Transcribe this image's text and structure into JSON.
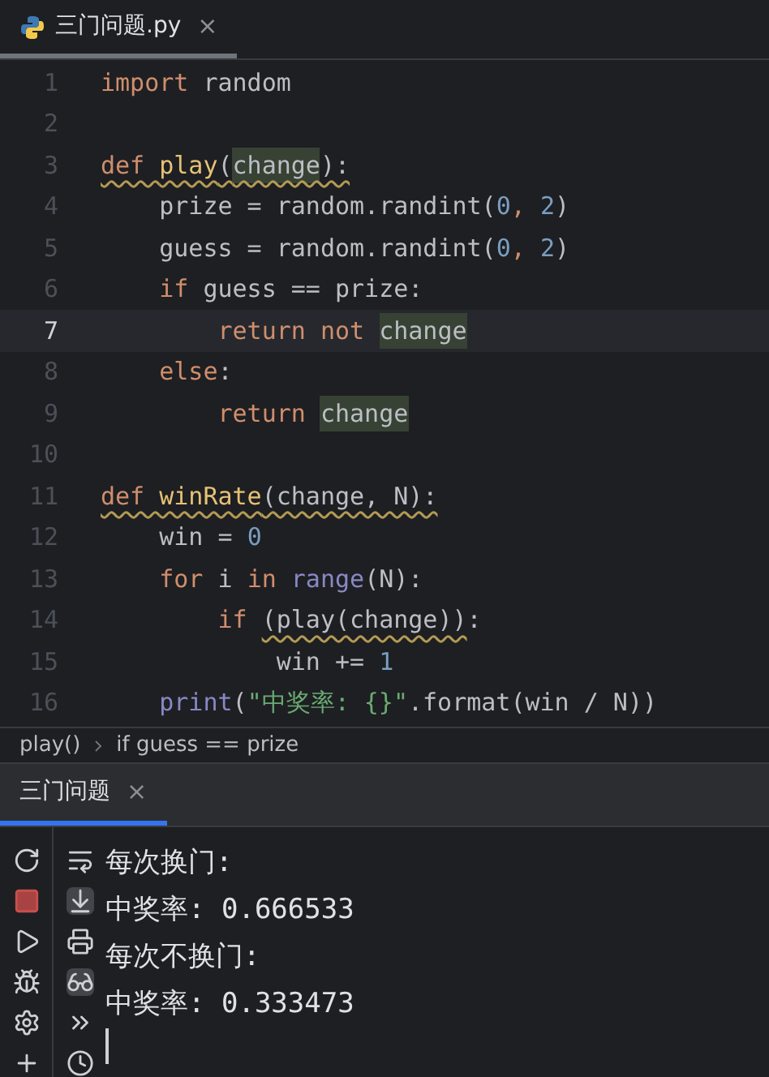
{
  "editor_tab": {
    "title": "三门问题.py",
    "close": "×",
    "selected": true
  },
  "lines": [
    {
      "number": "1",
      "current": false,
      "tokens": [
        {
          "text": "import",
          "kind": "keyword"
        },
        {
          "text": " random",
          "kind": "text"
        }
      ]
    },
    {
      "number": "2",
      "current": false
    },
    {
      "number": "3",
      "current": false,
      "tokens": [
        {
          "text": "def ",
          "kind": "keyword",
          "warning": true
        },
        {
          "text": "play",
          "kind": "func",
          "warning": true
        },
        {
          "text": "(",
          "kind": "text",
          "warning": true
        },
        {
          "text": "change",
          "kind": "text",
          "warning": true,
          "highlighted": true
        },
        {
          "text": "):",
          "kind": "text",
          "warning": true
        }
      ]
    },
    {
      "number": "4",
      "current": false,
      "tokens": [
        {
          "text": "    prize = random.randint(",
          "kind": "text"
        },
        {
          "text": "0",
          "kind": "number"
        },
        {
          "text": ", ",
          "kind": "keyword"
        },
        {
          "text": "2",
          "kind": "number"
        },
        {
          "text": ")",
          "kind": "text"
        }
      ]
    },
    {
      "number": "5",
      "current": false,
      "tokens": [
        {
          "text": "    guess = random.randint(",
          "kind": "text"
        },
        {
          "text": "0",
          "kind": "number"
        },
        {
          "text": ", ",
          "kind": "keyword"
        },
        {
          "text": "2",
          "kind": "number"
        },
        {
          "text": ")",
          "kind": "text"
        }
      ]
    },
    {
      "number": "6",
      "current": false,
      "tokens": [
        {
          "text": "    if",
          "kind": "keyword"
        },
        {
          "text": " guess == prize:",
          "kind": "text"
        }
      ]
    },
    {
      "number": "7",
      "current": true,
      "tokens": [
        {
          "text": "        return not ",
          "kind": "keyword"
        },
        {
          "text": "change",
          "kind": "text",
          "highlighted": true
        }
      ]
    },
    {
      "number": "8",
      "current": false,
      "tokens": [
        {
          "text": "    else",
          "kind": "keyword"
        },
        {
          "text": ":",
          "kind": "text"
        }
      ]
    },
    {
      "number": "9",
      "current": false,
      "tokens": [
        {
          "text": "        return ",
          "kind": "keyword"
        },
        {
          "text": "change",
          "kind": "text",
          "highlighted": true
        }
      ]
    },
    {
      "number": "10",
      "current": false
    },
    {
      "number": "11",
      "current": false,
      "tokens": [
        {
          "text": "def ",
          "kind": "keyword",
          "warning": true
        },
        {
          "text": "winRate",
          "kind": "func",
          "warning": true
        },
        {
          "text": "(change, N):",
          "kind": "text",
          "warning": true
        }
      ]
    },
    {
      "number": "12",
      "current": false,
      "tokens": [
        {
          "text": "    win = ",
          "kind": "text"
        },
        {
          "text": "0",
          "kind": "number"
        }
      ]
    },
    {
      "number": "13",
      "current": false,
      "tokens": [
        {
          "text": "    for",
          "kind": "keyword"
        },
        {
          "text": " i ",
          "kind": "text"
        },
        {
          "text": "in ",
          "kind": "keyword"
        },
        {
          "text": "range",
          "kind": "builtin"
        },
        {
          "text": "(N):",
          "kind": "text"
        }
      ]
    },
    {
      "number": "14",
      "current": false,
      "tokens": [
        {
          "text": "        if ",
          "kind": "keyword"
        },
        {
          "text": "(play(change))",
          "kind": "text",
          "warning": true
        },
        {
          "text": ":",
          "kind": "text"
        }
      ]
    },
    {
      "number": "15",
      "current": false,
      "tokens": [
        {
          "text": "            win += ",
          "kind": "text"
        },
        {
          "text": "1",
          "kind": "number"
        }
      ]
    },
    {
      "number": "16",
      "current": false,
      "tokens": [
        {
          "text": "    print",
          "kind": "builtin"
        },
        {
          "text": "(",
          "kind": "text"
        },
        {
          "text": "\"中奖率: {}\"",
          "kind": "string"
        },
        {
          "text": ".format(win / N))",
          "kind": "text"
        }
      ]
    }
  ],
  "breadcrumb": [
    "play()",
    "if guess == prize"
  ],
  "run_tab": {
    "title": "三门问题",
    "close": "×",
    "selected": true
  },
  "console": [
    "每次换门:",
    "中奖率: 0.666533",
    "每次不换门:",
    "中奖率: 0.333473"
  ]
}
